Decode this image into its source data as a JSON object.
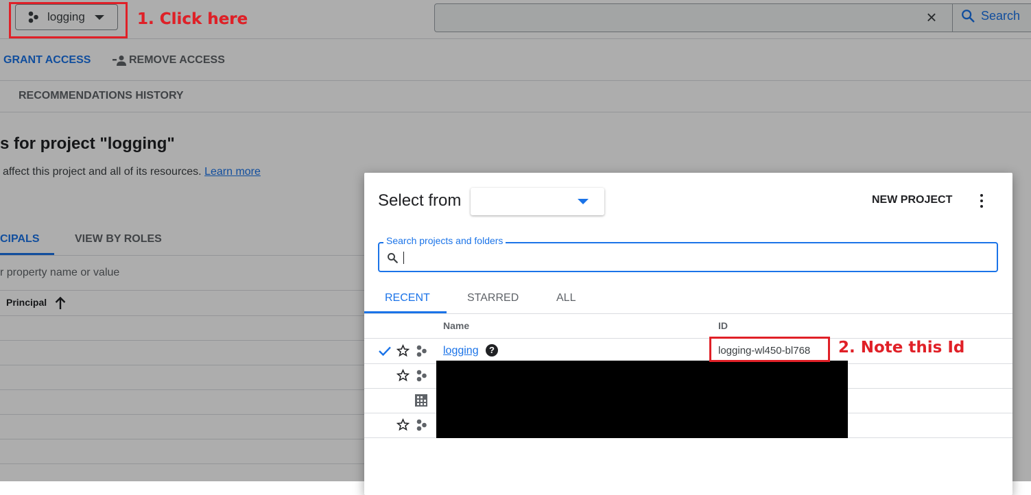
{
  "header": {
    "project_selector_label": "logging",
    "annotation_step1": "1. Click here",
    "search_button_label": "Search",
    "search_clear_icon": "close-icon"
  },
  "actions": {
    "grant_access": "GRANT ACCESS",
    "remove_access": "REMOVE ACCESS",
    "recommendations_history": "RECOMMENDATIONS HISTORY"
  },
  "page": {
    "title": "s for project \"logging\"",
    "subtitle": "affect this project and all of its resources.",
    "learn_more": "Learn more"
  },
  "view_tabs": [
    {
      "label": "CIPALS"
    },
    {
      "label": "VIEW BY ROLES"
    }
  ],
  "filter_placeholder": "r property name or value",
  "table": {
    "principal_header": "Principal"
  },
  "dialog": {
    "title": "Select from",
    "select_value": "",
    "new_project": "NEW PROJECT",
    "search_label": "Search projects and folders",
    "search_value": "",
    "tabs": [
      {
        "label": "RECENT"
      },
      {
        "label": "STARRED"
      },
      {
        "label": "ALL"
      }
    ],
    "columns": {
      "name": "Name",
      "id": "ID"
    },
    "rows": [
      {
        "name": "logging",
        "id": "logging-wl450-bl768",
        "selected": true,
        "starred": false,
        "type": "project"
      },
      {
        "name": "",
        "id": "",
        "type": "project"
      },
      {
        "name": "",
        "id": "",
        "type": "organization"
      },
      {
        "name": "",
        "id": "",
        "type": "project"
      }
    ],
    "annotation_step2": "2. Note this Id"
  },
  "colors": {
    "accent": "#1a73e8",
    "annotation_red": "#e02027",
    "overlay": "rgba(0,0,0,0.32)"
  }
}
